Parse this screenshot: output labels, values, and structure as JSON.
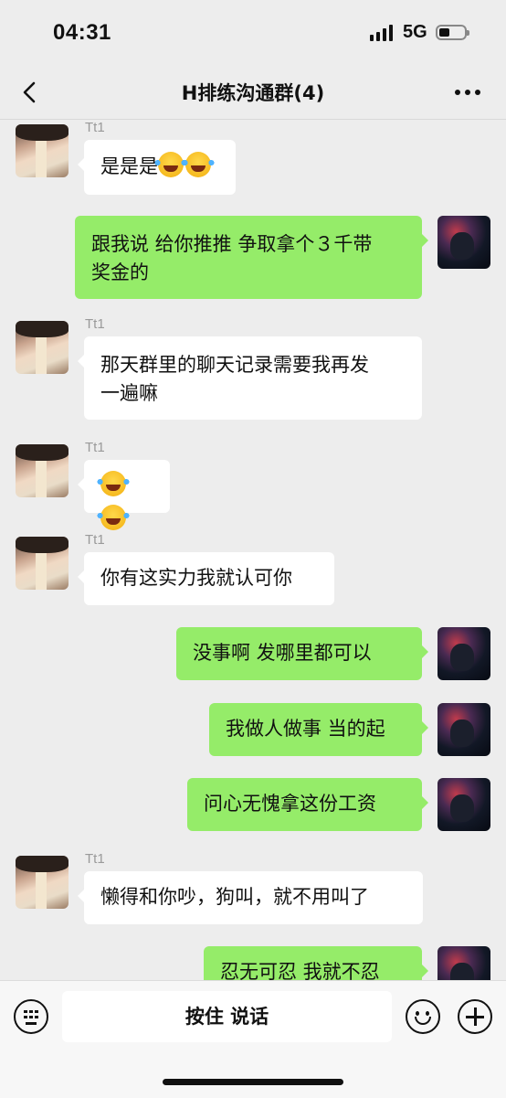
{
  "status_bar": {
    "time": "04:31",
    "network": "5G"
  },
  "header": {
    "title": "H排练沟通群(4)"
  },
  "messages": [
    {
      "side": "in",
      "sender": "Tt1",
      "text": "是是是",
      "emoji_count": 2
    },
    {
      "side": "out",
      "lines": [
        "跟我说 给你推推 争取拿个３千带",
        "奖金的"
      ]
    },
    {
      "side": "in",
      "sender": "Tt1",
      "lines": [
        "那天群里的聊天记录需要我再发",
        "一遍嘛"
      ]
    },
    {
      "side": "in",
      "sender": "Tt1",
      "text": "",
      "emoji_count": 2
    },
    {
      "side": "in",
      "sender": "Tt1",
      "text": "你有这实力我就认可你"
    },
    {
      "side": "out",
      "text": "没事啊 发哪里都可以"
    },
    {
      "side": "out",
      "text": "我做人做事 当的起"
    },
    {
      "side": "out",
      "text": "问心无愧拿这份工资"
    },
    {
      "side": "in",
      "sender": "Tt1",
      "text": "懒得和你吵，狗叫，就不用叫了"
    },
    {
      "side": "out",
      "text": "忍无可忍 我就不忍"
    }
  ],
  "input_bar": {
    "hold_to_talk": "按住 说话"
  },
  "icons": [
    "back-arrow-icon",
    "more-dots-icon",
    "keyboard-icon",
    "emoji-icon",
    "plus-icon",
    "laughing-tears-emoji"
  ],
  "colors": {
    "background": "#ededed",
    "outgoing_bubble": "#95ec69",
    "incoming_bubble": "#ffffff"
  }
}
